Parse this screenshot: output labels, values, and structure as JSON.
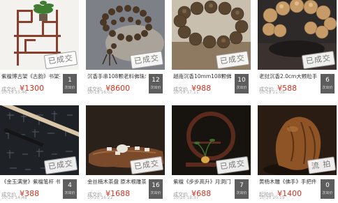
{
  "items": [
    {
      "title": "紫檀博古架《古韵》书架茶台摆件",
      "price_label": "成交价",
      "price": "¥1300",
      "time": "10-19 15:46",
      "bids": "1",
      "bids_unit": "次出价",
      "stamp": "已成交"
    },
    {
      "title": "沉香手串108颗老料佛珠念珠手链",
      "price_label": "成交价",
      "price": "¥8600",
      "time": "10-19 16:02",
      "bids": "12",
      "bids_unit": "次出价",
      "stamp": "已成交"
    },
    {
      "title": "越南沉香10mm108颗佛珠手串",
      "price_label": "成交价",
      "price": "¥988",
      "time": "10-19 17:11",
      "bids": "10",
      "bids_unit": "次出价",
      "stamp": "已成交"
    },
    {
      "title": "老挝沉香2.0cm大颗粒手串佛珠",
      "price_label": "成交价",
      "price": "¥588",
      "time": "10-19 21:05",
      "bids": "6",
      "bids_unit": "次出价",
      "stamp": "已成交"
    },
    {
      "title": "《金玉满堂》紫檀笔杆 书法用笔",
      "price_label": "成交价",
      "price": "¥388",
      "time": "10-20 14:48",
      "bids": "4",
      "bids_unit": "次出价",
      "stamp": "已成交"
    },
    {
      "title": "金丝楠木茶盘 原木根雕茶海茶台",
      "price_label": "成交价",
      "price": "¥1688",
      "time": "10-20 16:22",
      "bids": "16",
      "bids_unit": "次出价",
      "stamp": "已成交"
    },
    {
      "title": "紫檀《步步高升》月洞门 花器摆件",
      "price_label": "成交价",
      "price": "¥688",
      "time": "10-20 18:37",
      "bids": "7",
      "bids_unit": "次出价",
      "stamp": "已成交"
    },
    {
      "title": "黄杨木雕《佛手》手把件 把玩件",
      "price_label": "起拍价",
      "price": "¥1400",
      "time": "10-20 20:15",
      "bids": "0",
      "bids_unit": "次出价",
      "stamp": "流 拍"
    }
  ]
}
